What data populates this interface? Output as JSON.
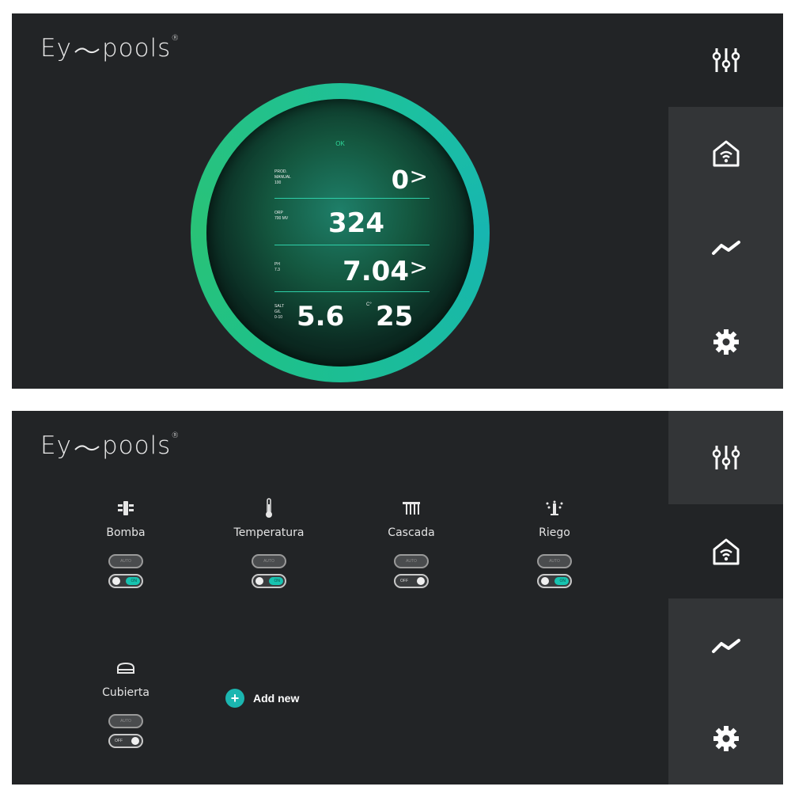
{
  "colors": {
    "background": "#222426",
    "accent": "#1bb6b0",
    "active_sidebar": "#222426",
    "inactive_sidebar": "#333537",
    "ring_green": "#29c277",
    "ring_teal": "#17b6b0"
  },
  "screen1": {
    "logo": "Ey pools",
    "sidebar": [
      {
        "icon": "sliders-icon",
        "active": true
      },
      {
        "icon": "home-wifi-icon",
        "active": false
      },
      {
        "icon": "trend-icon",
        "active": false
      },
      {
        "icon": "gear-icon",
        "active": false
      }
    ],
    "gauge": {
      "status": "OK",
      "rows": [
        {
          "label_lines": [
            "PROD.",
            "MANUAL",
            "100"
          ],
          "value": "0",
          "chevron": ">"
        },
        {
          "label_lines": [
            "ORP",
            "",
            "700 mV"
          ],
          "value": "324",
          "chevron": ""
        },
        {
          "label_lines": [
            "pH",
            "",
            "7.3"
          ],
          "value": "7.04",
          "chevron": ">"
        },
        {
          "label_lines": [
            "SALT",
            "g/l",
            "0-10"
          ],
          "value": "5.6",
          "unit": "C°",
          "value2": "25"
        }
      ]
    }
  },
  "screen2": {
    "logo": "Ey pools",
    "sidebar": [
      {
        "icon": "sliders-icon",
        "active": false
      },
      {
        "icon": "home-wifi-icon",
        "active": true
      },
      {
        "icon": "trend-icon",
        "active": false
      },
      {
        "icon": "gear-icon",
        "active": false
      }
    ],
    "devices": [
      {
        "name": "Bomba",
        "icon": "pump-icon",
        "auto_label": "AUTO",
        "toggle_state": "ON"
      },
      {
        "name": "Temperatura",
        "icon": "thermometer-icon",
        "auto_label": "AUTO",
        "toggle_state": "ON"
      },
      {
        "name": "Cascada",
        "icon": "waterfall-icon",
        "auto_label": "AUTO",
        "toggle_state": "OFF"
      },
      {
        "name": "Riego",
        "icon": "sprinkler-icon",
        "auto_label": "AUTO",
        "toggle_state": "ON"
      },
      {
        "name": "Cubierta",
        "icon": "cover-icon",
        "auto_label": "AUTO",
        "toggle_state": "OFF"
      }
    ],
    "add_new": "Add new"
  }
}
